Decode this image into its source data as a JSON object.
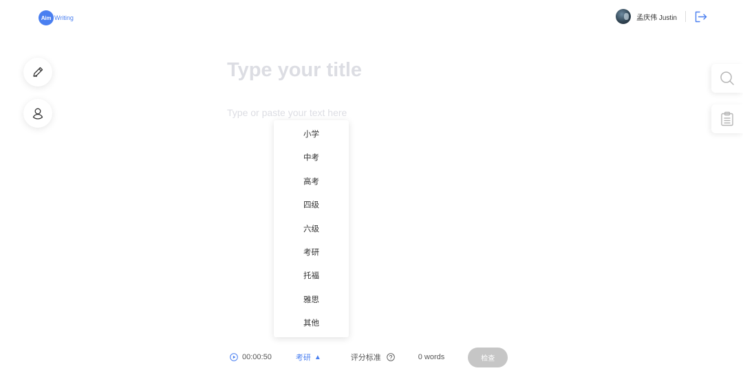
{
  "header": {
    "logo_mark": "Aim",
    "logo_text": "Writing",
    "user_name": "孟庆伟 Justin"
  },
  "editor": {
    "title_placeholder": "Type your title",
    "body_placeholder": "Type or paste your text here"
  },
  "level_dropdown": {
    "options": [
      "小学",
      "中考",
      "高考",
      "四级",
      "六级",
      "考研",
      "托福",
      "雅思",
      "其他"
    ]
  },
  "bottom_bar": {
    "timer": "00:00:50",
    "selected_level": "考研",
    "selected_arrow": "▲",
    "scoring_standard": "评分标准",
    "word_count": "0 words",
    "check_label": "检查"
  },
  "icons": {
    "left_tools": [
      "pencil-icon",
      "person-icon"
    ],
    "right_tools": [
      "search-icon",
      "clipboard-icon"
    ],
    "header": [
      "logout-icon"
    ]
  },
  "colors": {
    "accent": "#4a7ff0",
    "placeholder": "#dcdde3",
    "disabled_button": "#c6c6c6"
  }
}
